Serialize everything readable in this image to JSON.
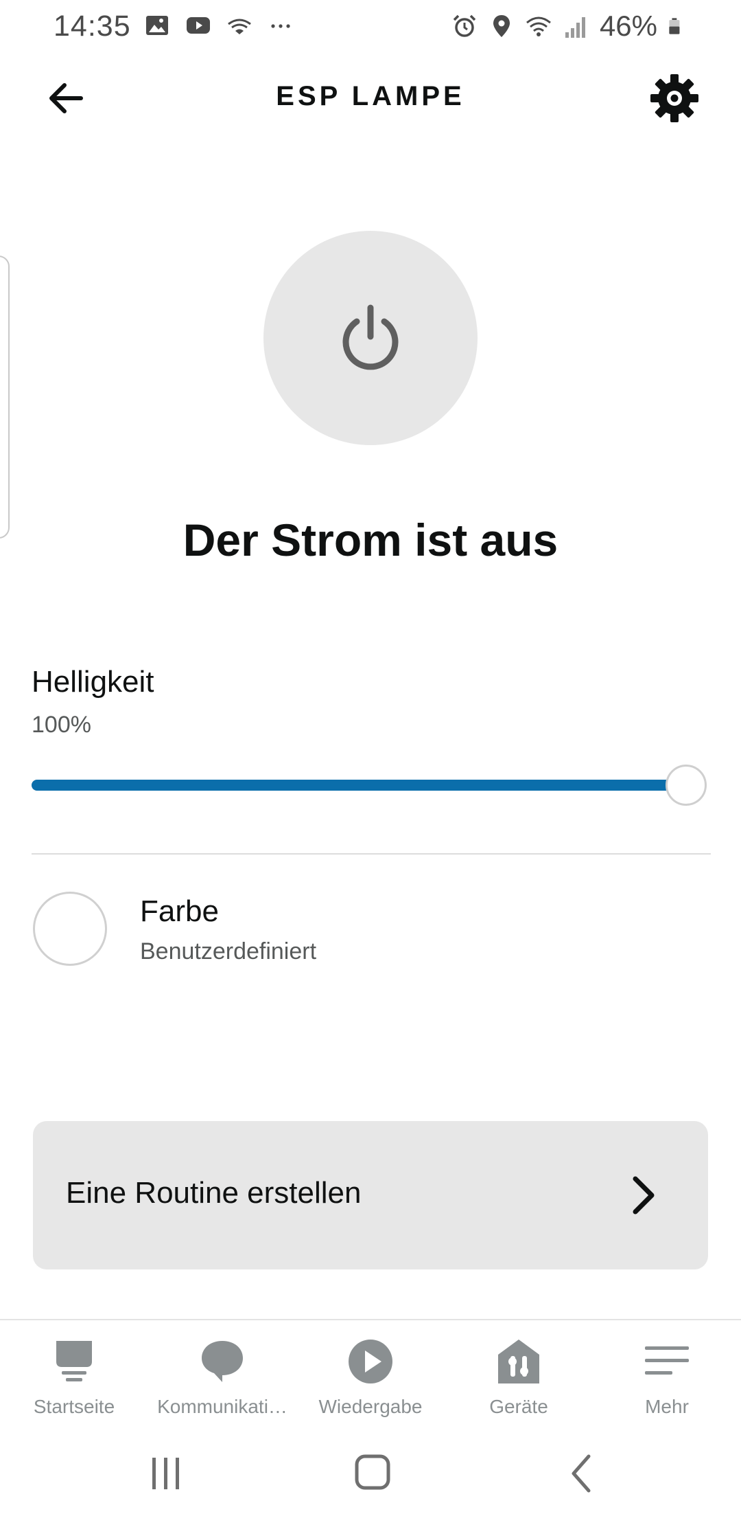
{
  "status_bar": {
    "time": "14:35",
    "battery_percent": "46%"
  },
  "header": {
    "title": "ESP LAMPE"
  },
  "power": {
    "status_text": "Der Strom ist aus",
    "is_on": false
  },
  "brightness": {
    "label": "Helligkeit",
    "value_text": "100%",
    "value": 100
  },
  "color": {
    "label": "Farbe",
    "value": "Benutzerdefiniert",
    "swatch_color": "#ffffff"
  },
  "routine": {
    "label": "Eine Routine erstellen"
  },
  "bottom_nav": {
    "items": [
      {
        "label": "Startseite",
        "icon": "home-icon"
      },
      {
        "label": "Kommunikati…",
        "icon": "chat-bubble-icon"
      },
      {
        "label": "Wiedergabe",
        "icon": "play-icon"
      },
      {
        "label": "Geräte",
        "icon": "devices-icon"
      },
      {
        "label": "Mehr",
        "icon": "menu-icon"
      }
    ]
  },
  "colors": {
    "accent": "#0b6eab",
    "text_primary": "#0f1111",
    "text_secondary": "#565959",
    "nav_inactive": "#8a8f91",
    "surface": "#e7e7e7"
  }
}
